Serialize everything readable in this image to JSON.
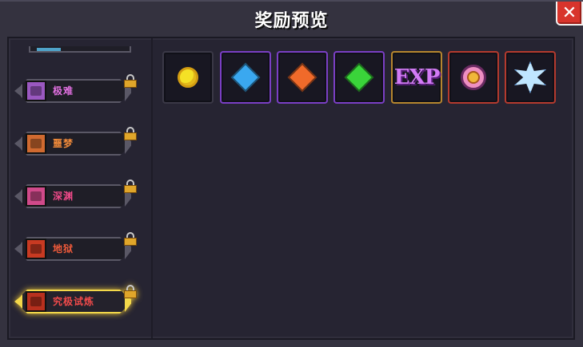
{
  "window": {
    "title": "奖励预览",
    "close_glyph": "✕"
  },
  "sidebar": {
    "items": [
      {
        "label": "极难",
        "color": "#e070e0",
        "icon_color": "#9a58c0",
        "locked": true,
        "selected": false
      },
      {
        "label": "噩梦",
        "color": "#f08a3a",
        "icon_color": "#d06a30",
        "locked": true,
        "selected": false
      },
      {
        "label": "深渊",
        "color": "#f04a8a",
        "icon_color": "#d04a8a",
        "locked": true,
        "selected": false
      },
      {
        "label": "地狱",
        "color": "#f05a3a",
        "icon_color": "#c83a22",
        "locked": true,
        "selected": false
      },
      {
        "label": "究极试炼",
        "color": "#f04a4a",
        "icon_color": "#b8301e",
        "locked": true,
        "selected": true
      }
    ]
  },
  "rewards": {
    "items": [
      {
        "name": "gold-coin-icon",
        "rarity": "normal"
      },
      {
        "name": "blue-gem-icon",
        "rarity": "purple",
        "color": "#3aa8f0"
      },
      {
        "name": "orange-gem-icon",
        "rarity": "purple",
        "color": "#f06a2a"
      },
      {
        "name": "green-gem-icon",
        "rarity": "purple",
        "color": "#3ad43a"
      },
      {
        "name": "exp-icon",
        "rarity": "gold",
        "text": "EXP"
      },
      {
        "name": "ring-icon",
        "rarity": "red"
      },
      {
        "name": "crystal-icon",
        "rarity": "red"
      }
    ]
  }
}
